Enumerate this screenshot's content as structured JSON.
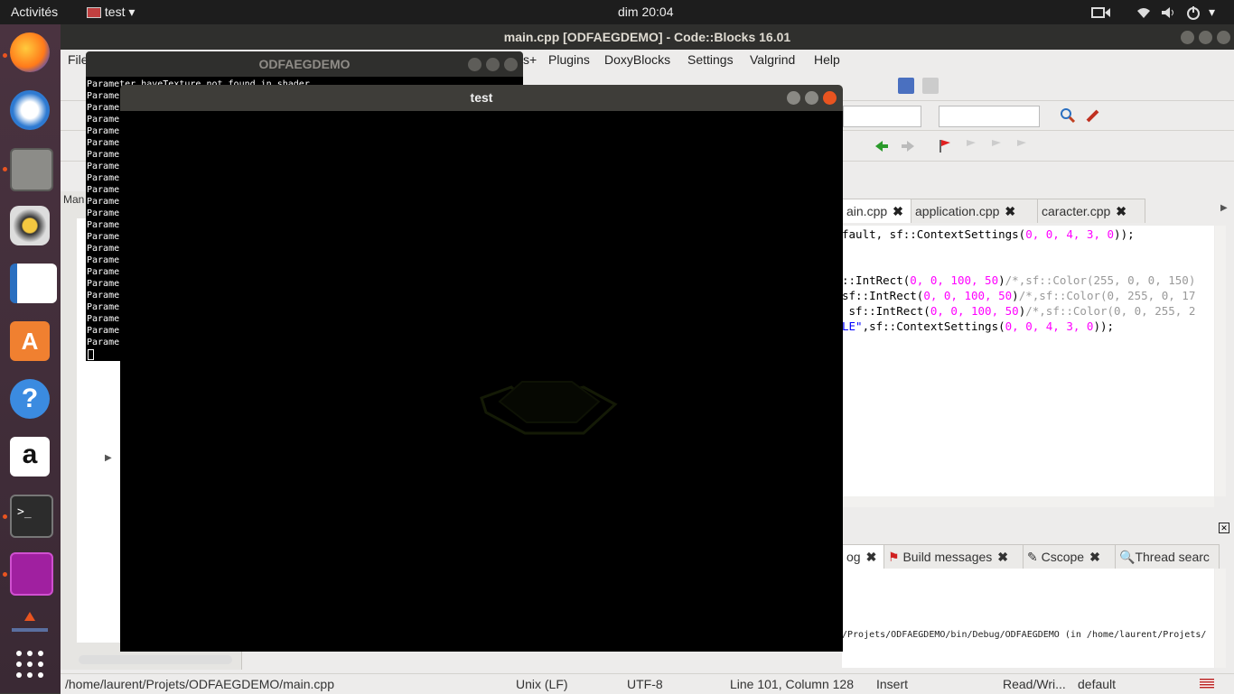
{
  "topbar": {
    "activities": "Activités",
    "app_menu": "test",
    "clock": "dim 20:04"
  },
  "dock": {
    "items": [
      "firefox-icon",
      "thunderbird-icon",
      "files-icon",
      "rhythmbox-icon",
      "writer-icon",
      "software-center-icon",
      "help-icon",
      "amazon-icon",
      "terminal-icon",
      "screen-recorder-icon",
      "install-icon",
      "show-apps-icon"
    ]
  },
  "codeblocks": {
    "title": "main.cpp [ODFAEGDEMO] - Code::Blocks 16.01",
    "menu": [
      "File",
      "s+",
      "Plugins",
      "DoxyBlocks",
      "Settings",
      "Valgrind",
      "Help"
    ],
    "left_panel_label": "Man",
    "editor_tabs": [
      {
        "label": "ain.cpp"
      },
      {
        "label": "application.cpp"
      },
      {
        "label": "caracter.cpp"
      }
    ],
    "bottom_tabs": [
      {
        "label": "og"
      },
      {
        "label": "Build messages"
      },
      {
        "label": "Cscope"
      },
      {
        "label": "Thread searc"
      }
    ],
    "log_line": "/Projets/ODFAEGDEMO/bin/Debug/ODFAEGDEMO  (in /home/laurent/Projets/",
    "status": {
      "path": "/home/laurent/Projets/ODFAEGDEMO/main.cpp",
      "line_endings": "Unix (LF)",
      "encoding": "UTF-8",
      "position": "Line 101, Column 128",
      "mode": "Insert",
      "access": "Read/Wri...",
      "profile": "default"
    }
  },
  "code": {
    "line1": {
      "a": "fault, sf::ContextSettings(",
      "b": "0, 0, 4, 3, 0",
      "c": "));"
    },
    "line3": {
      "a": "::IntRect(",
      "b": "0, 0, 100, 50",
      "c": ")",
      "d": "/*,sf::Color(255, 0, 0, 150)"
    },
    "line4": {
      "a": "sf::IntRect(",
      "b": "0, 0, 100, 50",
      "c": ")",
      "d": "/*,sf::Color(0, 255, 0, 17"
    },
    "line5": {
      "a": " sf::IntRect(",
      "b": "0, 0, 100, 50",
      "c": ")",
      "d": "/*,sf::Color(0, 0, 255, 2"
    },
    "line6": {
      "a": "LE\"",
      "b": ",sf::ContextSettings(",
      "c": "0, 0, 4, 3, 0",
      "d": "));"
    }
  },
  "terminal": {
    "title": "ODFAEGDEMO",
    "first_line": "Parameter haveTexture not found in shader",
    "line": "Parame"
  },
  "test_window": {
    "title": "test"
  },
  "colors": {
    "accent": "#e95420",
    "close": "#e95420"
  }
}
